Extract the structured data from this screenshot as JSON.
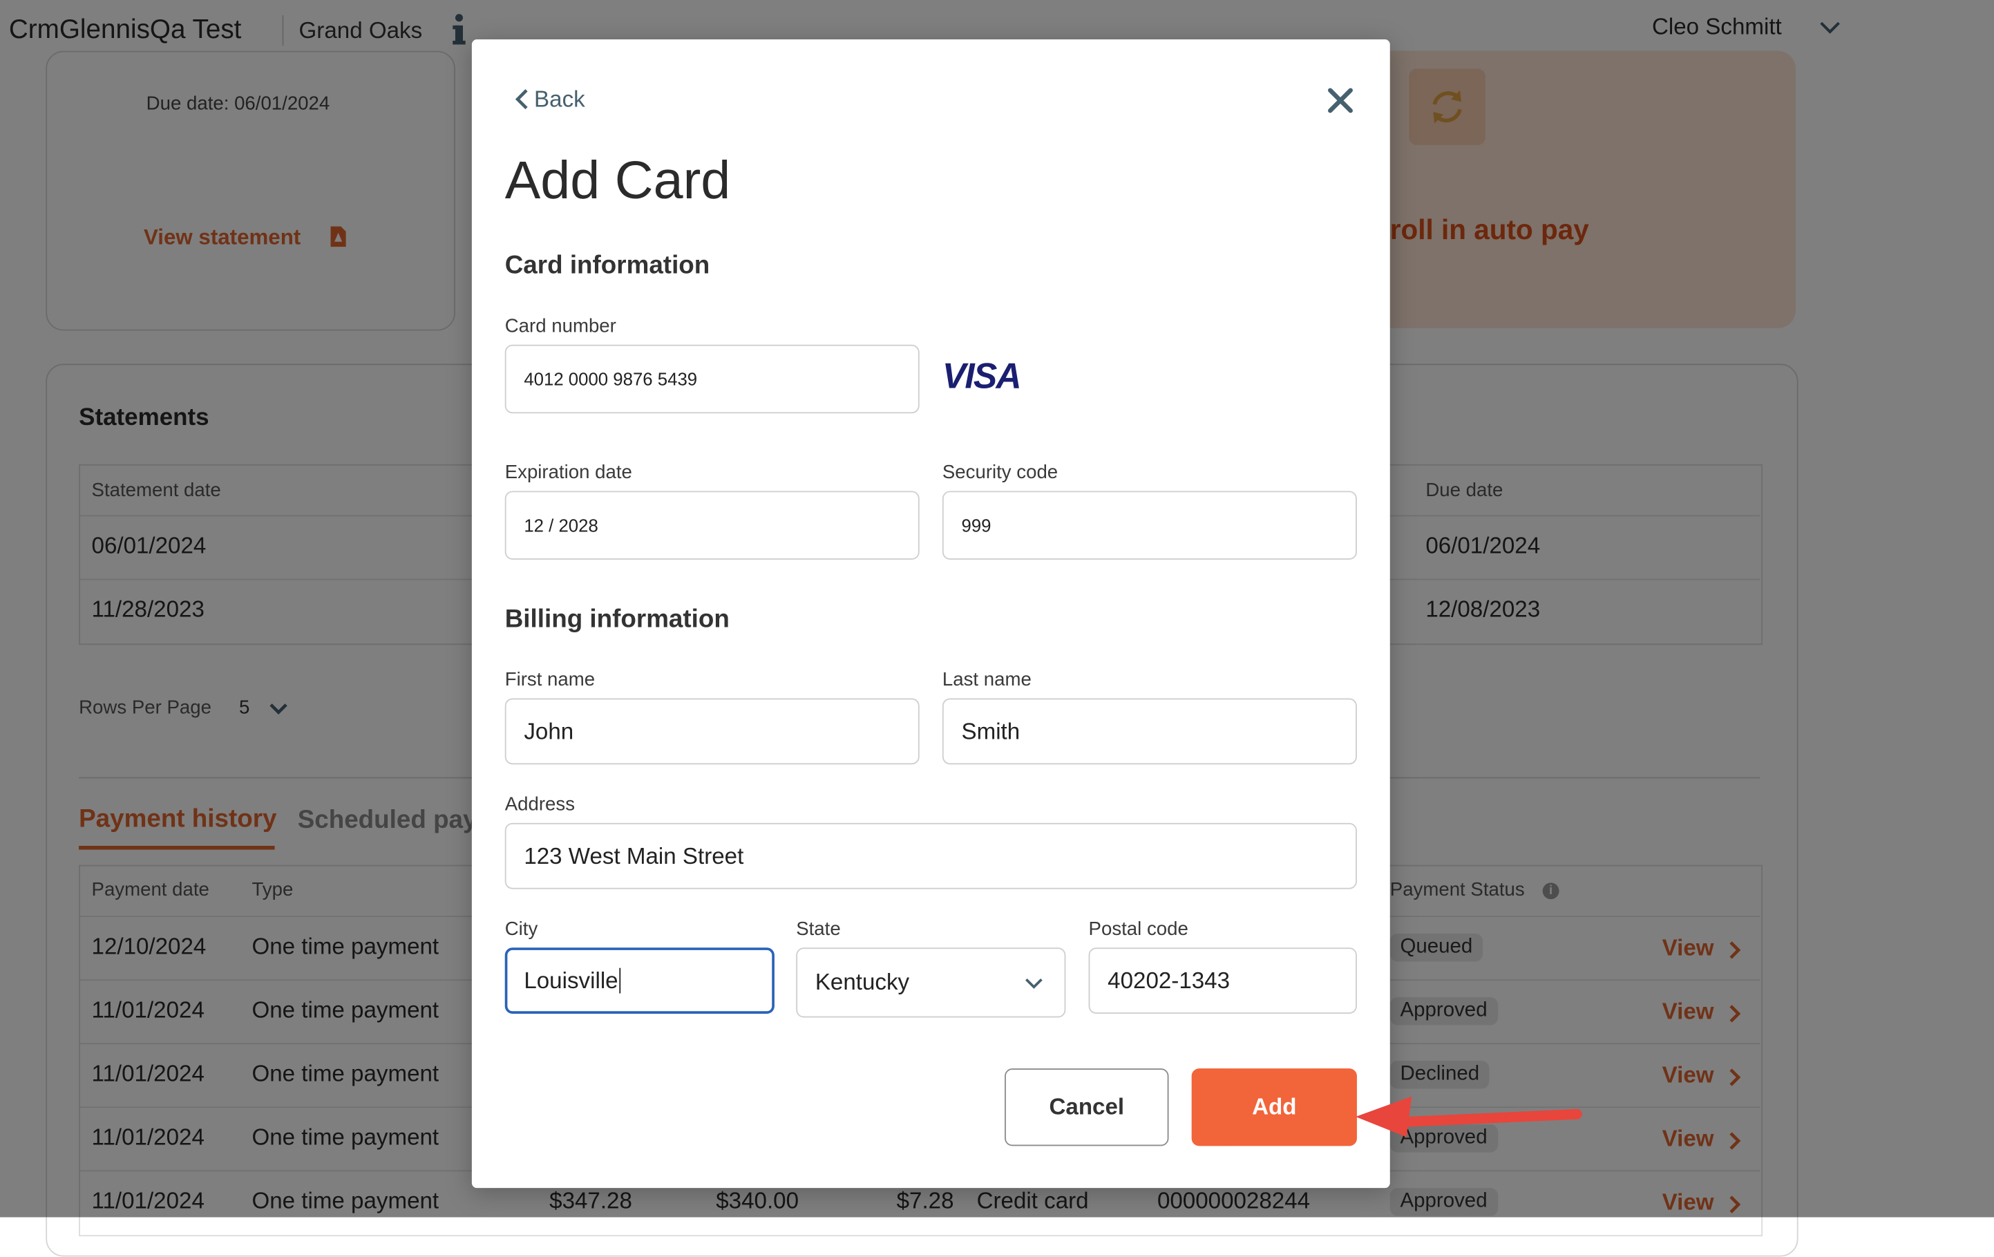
{
  "header": {
    "app_title": "CrmGlennisQa Test",
    "org_name": "Grand Oaks",
    "user_name": "Cleo Schmitt"
  },
  "statement_card": {
    "due_date": "Due date: 06/01/2024",
    "view_statement": "View statement"
  },
  "autopay": {
    "text": "roll in auto pay"
  },
  "statements": {
    "title": "Statements",
    "columns": {
      "statement_date": "Statement date",
      "due_date": "Due date"
    },
    "rows": [
      {
        "statement_date": "06/01/2024",
        "due_date": "06/01/2024"
      },
      {
        "statement_date": "11/28/2023",
        "due_date": "12/08/2023"
      }
    ],
    "rows_per_page_label": "Rows Per Page",
    "rows_per_page_value": "5"
  },
  "tabs": {
    "payment_history": "Payment history",
    "scheduled": "Scheduled pay"
  },
  "payment_history": {
    "columns": {
      "payment_date": "Payment date",
      "type": "Type",
      "status": "Payment Status"
    },
    "rows": [
      {
        "date": "12/10/2024",
        "type": "One time payment",
        "status": "Queued",
        "view": "View"
      },
      {
        "date": "11/01/2024",
        "type": "One time payment",
        "status": "Approved",
        "view": "View"
      },
      {
        "date": "11/01/2024",
        "type": "One time payment",
        "status": "Declined",
        "view": "View"
      },
      {
        "date": "11/01/2024",
        "type": "One time payment",
        "status": "Approved",
        "view": "View"
      },
      {
        "date": "11/01/2024",
        "type": "One time payment",
        "status": "Approved",
        "view": "View",
        "amount": "$347.28",
        "principal": "$340.00",
        "fee": "$7.28",
        "method": "Credit card",
        "reference": "000000028244"
      }
    ]
  },
  "modal": {
    "back_label": "Back",
    "title": "Add Card",
    "card_section": "Card information",
    "card_number_label": "Card number",
    "card_number": "4012 0000 9876 5439",
    "card_brand": "VISA",
    "expiration_label": "Expiration date",
    "expiration": "12 / 2028",
    "security_label": "Security code",
    "security": "999",
    "billing_section": "Billing information",
    "first_name_label": "First name",
    "first_name": "John",
    "last_name_label": "Last name",
    "last_name": "Smith",
    "address_label": "Address",
    "address": "123 West Main Street",
    "city_label": "City",
    "city": "Louisville",
    "state_label": "State",
    "state": "Kentucky",
    "postal_label": "Postal code",
    "postal": "40202-1343",
    "cancel_label": "Cancel",
    "add_label": "Add"
  },
  "colors": {
    "accent": "#f2643a",
    "link": "#e0642f",
    "focus": "#2a63b8",
    "annotation_arrow": "#e8453c"
  },
  "icons": {
    "info": "info-icon",
    "user_menu": "chevron-down-icon",
    "statement_pdf": "pdf-icon",
    "autopay_refresh": "refresh-icon",
    "back": "chevron-left-icon",
    "close": "close-icon",
    "state_select": "chevron-down-icon",
    "view_row": "chevron-right-icon"
  }
}
